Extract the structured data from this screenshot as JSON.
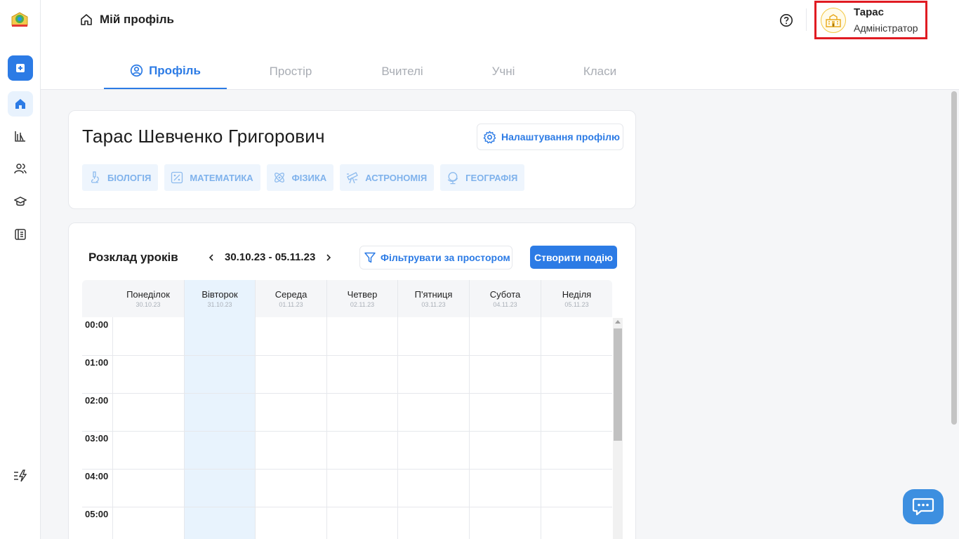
{
  "header": {
    "breadcrumb": "Мій профіль",
    "help_icon": "question-circle-icon",
    "user": {
      "name": "Тарас",
      "role": "Адміністратор"
    }
  },
  "tabs": [
    {
      "label": "Профіль",
      "active": true
    },
    {
      "label": "Простір",
      "active": false
    },
    {
      "label": "Вчителі",
      "active": false
    },
    {
      "label": "Учні",
      "active": false
    },
    {
      "label": "Класи",
      "active": false
    }
  ],
  "sidebar": {
    "items": [
      "add-icon",
      "home-icon",
      "stats-icon",
      "users-icon",
      "graduation-cap-icon",
      "book-icon",
      "bolt-icon"
    ]
  },
  "profile": {
    "full_name": "Тарас Шевченко Григорович",
    "settings_label": "Налаштування профілю",
    "subjects": [
      "БІОЛОГІЯ",
      "МАТЕМАТИКА",
      "ФІЗИКА",
      "АСТРОНОМІЯ",
      "ГЕОГРАФІЯ"
    ]
  },
  "schedule": {
    "title": "Розклад уроків",
    "date_range": "30.10.23 - 05.11.23",
    "filter_label": "Фільтрувати за простором",
    "create_label": "Створити подію",
    "days": [
      {
        "name": "Понеділок",
        "date": "30.10.23"
      },
      {
        "name": "Вівторок",
        "date": "31.10.23",
        "today": true
      },
      {
        "name": "Середа",
        "date": "01.11.23"
      },
      {
        "name": "Четвер",
        "date": "02.11.23"
      },
      {
        "name": "П'ятниця",
        "date": "03.11.23"
      },
      {
        "name": "Субота",
        "date": "04.11.23"
      },
      {
        "name": "Неділя",
        "date": "05.11.23"
      }
    ],
    "hours": [
      "00:00",
      "01:00",
      "02:00",
      "03:00",
      "04:00",
      "05:00"
    ]
  },
  "colors": {
    "accent": "#2c7be5",
    "highlight": "#e01b22",
    "today": "#e8f3fd"
  }
}
